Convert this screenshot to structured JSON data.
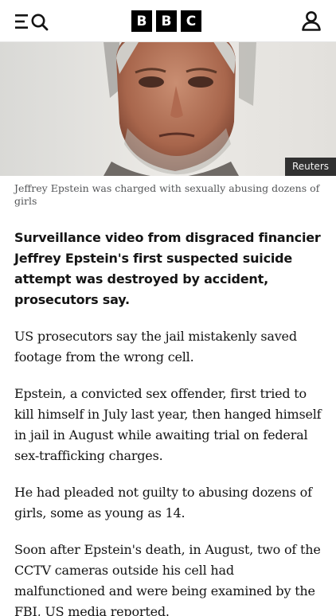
{
  "header": {
    "logo_letters": [
      "B",
      "B",
      "C"
    ],
    "menu_icon": "menu-icon",
    "search_icon": "search-icon",
    "account_icon": "account-icon"
  },
  "hero": {
    "credit": "Reuters",
    "caption": "Jeffrey Epstein was charged with sexually abusing dozens of girls"
  },
  "article": {
    "lead": "Surveillance video from disgraced financier Jeffrey Epstein's first suspected suicide attempt was destroyed by accident, prosecutors say.",
    "paragraphs": [
      "US prosecutors say the jail mistakenly saved footage from the wrong cell.",
      "Epstein, a convicted sex offender, first tried to kill himself in July last year, then hanged himself in jail in August while awaiting trial on federal sex-trafficking charges.",
      "He had pleaded not guilty to abusing dozens of girls, some as young as 14.",
      "Soon after Epstein's death, in August, two of the CCTV cameras outside his cell had malfunctioned and were being examined by the FBI, US media reported."
    ]
  }
}
